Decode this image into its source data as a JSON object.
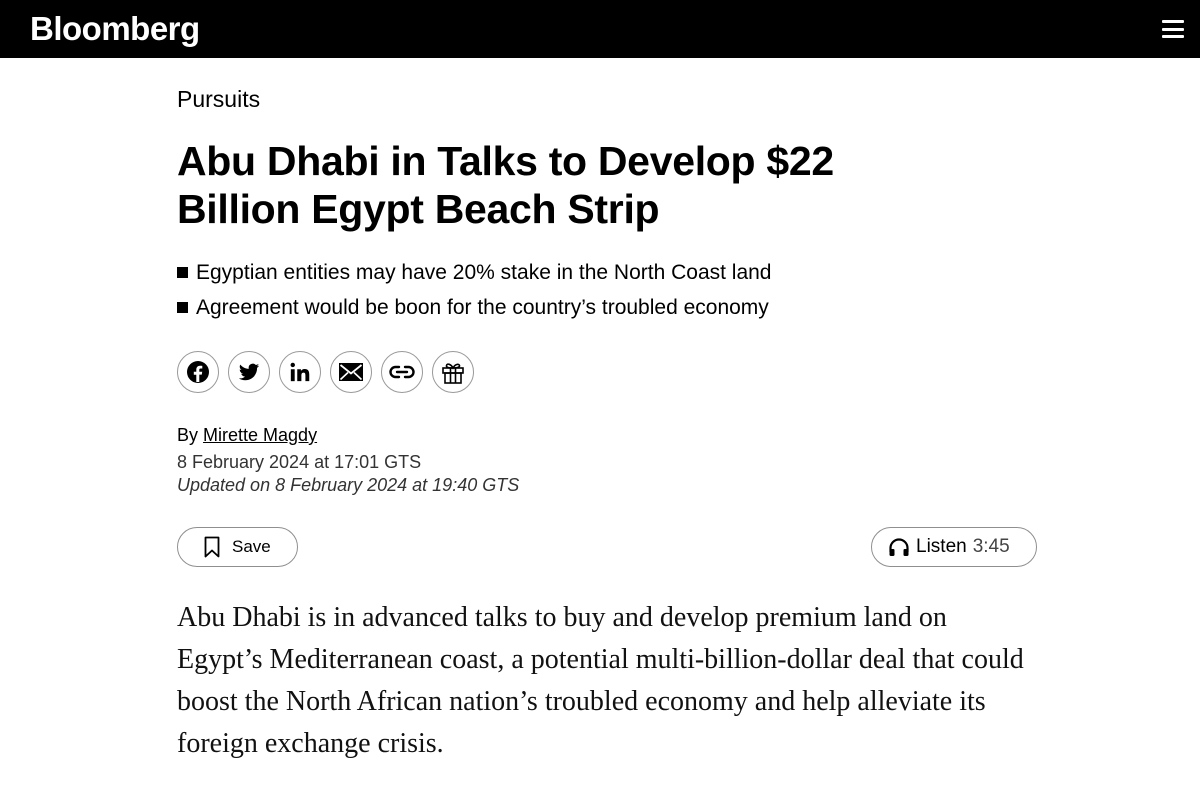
{
  "header": {
    "logo": "Bloomberg",
    "menu_icon": "hamburger-icon"
  },
  "article": {
    "kicker": "Pursuits",
    "headline": "Abu Dhabi in Talks to Develop $22 Billion Egypt Beach Strip",
    "bullets": [
      "Egyptian entities may have 20% stake in the North Coast land",
      "Agreement would be boon for the country’s troubled economy"
    ],
    "share_icons": [
      "facebook-icon",
      "twitter-icon",
      "linkedin-icon",
      "email-icon",
      "link-icon",
      "gift-icon"
    ],
    "byline_prefix": "By",
    "author": "Mirette Magdy",
    "published": "8 February 2024 at 17:01 GTS",
    "updated": "Updated on 8 February 2024 at 19:40 GTS",
    "save_label": "Save",
    "listen_label": "Listen",
    "listen_duration": "3:45",
    "body": "Abu Dhabi is in advanced talks to buy and develop premium land on Egypt’s Mediterranean coast, a potential multi-billion-dollar deal that could boost the North African nation’s troubled economy and help alleviate its foreign exchange crisis."
  }
}
